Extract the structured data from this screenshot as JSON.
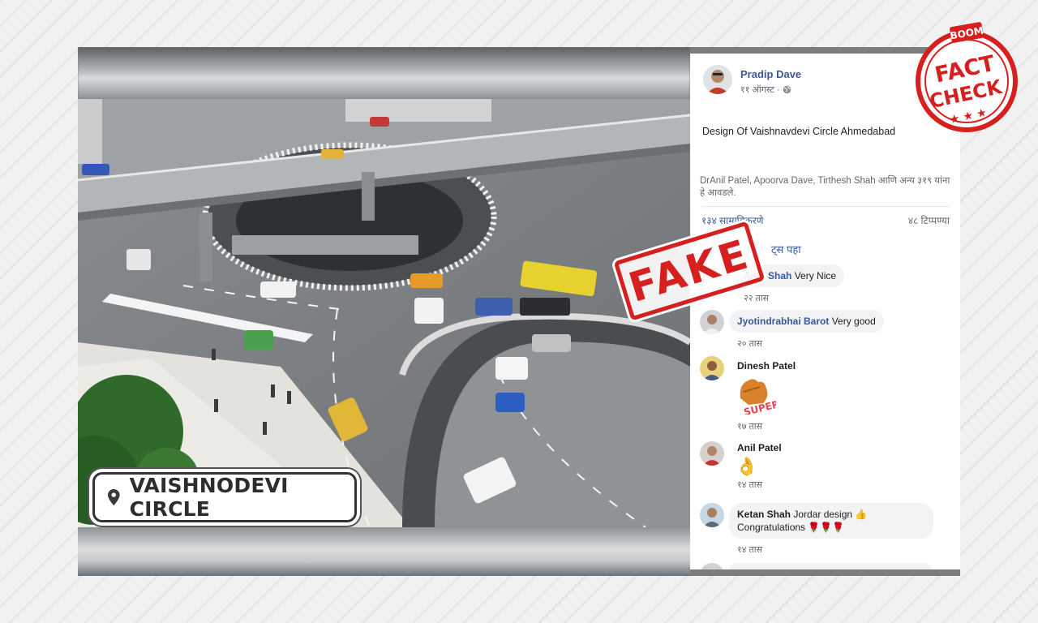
{
  "image_overlay": {
    "location_label": "VAISHNODEVI CIRCLE",
    "location_icon": "map-pin-icon"
  },
  "stamps": {
    "fake": "FAKE",
    "fact_check_brand": "BOOM",
    "fact_check_line1": "FACT",
    "fact_check_line2": "CHECK",
    "stars": "★ ★ ★",
    "color": "#d62020"
  },
  "post": {
    "author": "Pradip Dave",
    "time": "११ ऑगस्ट ·",
    "privacy_icon": "globe-icon",
    "text": "Design Of Vaishnavdevi Circle Ahmedabad",
    "likers": "DrAnil Patel, Apoorva Dave, Tirthesh Shah आणि अन्य ३१९ यांना हे आवडले.",
    "shares": "१३४ सामायिकरणे",
    "comments_count": "४८ टिप्पण्या",
    "more_comments": "ट्स पहा"
  },
  "comments": [
    {
      "name": "Amit Shah",
      "text": "Very Nice",
      "time": "२२ तास"
    },
    {
      "name": "Jyotindrabhai Barot",
      "text": "Very good",
      "time": "२० तास"
    },
    {
      "name": "Dinesh Patel",
      "sticker": "SUPER!",
      "time": "१७ तास"
    },
    {
      "name": "Anil Patel",
      "emoji": "👌",
      "time": "१४ तास"
    },
    {
      "name": "Ketan Shah",
      "text": "Jordar design 👍",
      "text2": "Congratulations 🌹🌹🌹",
      "time": "१४ तास"
    }
  ],
  "colors": {
    "fb_link": "#385898",
    "accent_red": "#d62020"
  }
}
